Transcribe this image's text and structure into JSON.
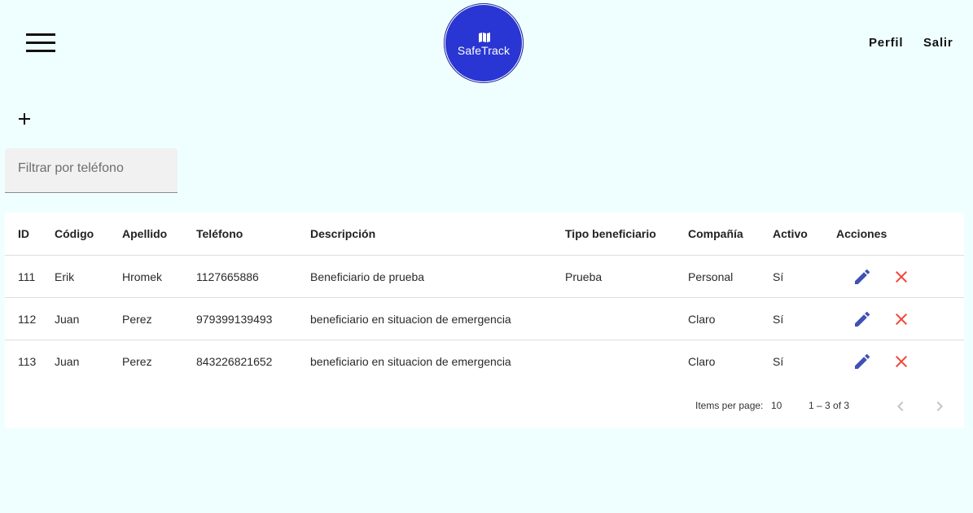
{
  "header": {
    "logo_text": "SafeTrack",
    "nav": [
      "Perfil",
      "Salir"
    ]
  },
  "filter": {
    "placeholder": "Filtrar por teléfono",
    "value": ""
  },
  "table": {
    "columns": [
      "ID",
      "Código",
      "Apellido",
      "Teléfono",
      "Descripción",
      "Tipo beneficiario",
      "Compañía",
      "Activo",
      "Acciones"
    ],
    "rows": [
      [
        "111",
        "Erik",
        "Hromek",
        "1127665886",
        "Beneficiario de prueba",
        "Prueba",
        "Personal",
        "Sí"
      ],
      [
        "112",
        "Juan",
        "Perez",
        "979399139493",
        "beneficiario en situacion de emergencia",
        "",
        "Claro",
        "Sí"
      ],
      [
        "113",
        "Juan",
        "Perez",
        "843226821652",
        "beneficiario en situacion de emergencia",
        "",
        "Claro",
        "Sí"
      ]
    ]
  },
  "paginator": {
    "items_per_page_label": "Items per page:",
    "page_size": "10",
    "range": "1 – 3 of 3"
  },
  "colors": {
    "background": "#efffff",
    "brand": "#2936d3",
    "edit_icon": "#3f51b5",
    "delete_icon": "#f44336"
  },
  "icons": {
    "menu": "hamburger-icon",
    "add": "plus-icon",
    "edit": "pencil-icon",
    "delete": "close-icon",
    "prev": "chevron-left-icon",
    "next": "chevron-right-icon"
  }
}
